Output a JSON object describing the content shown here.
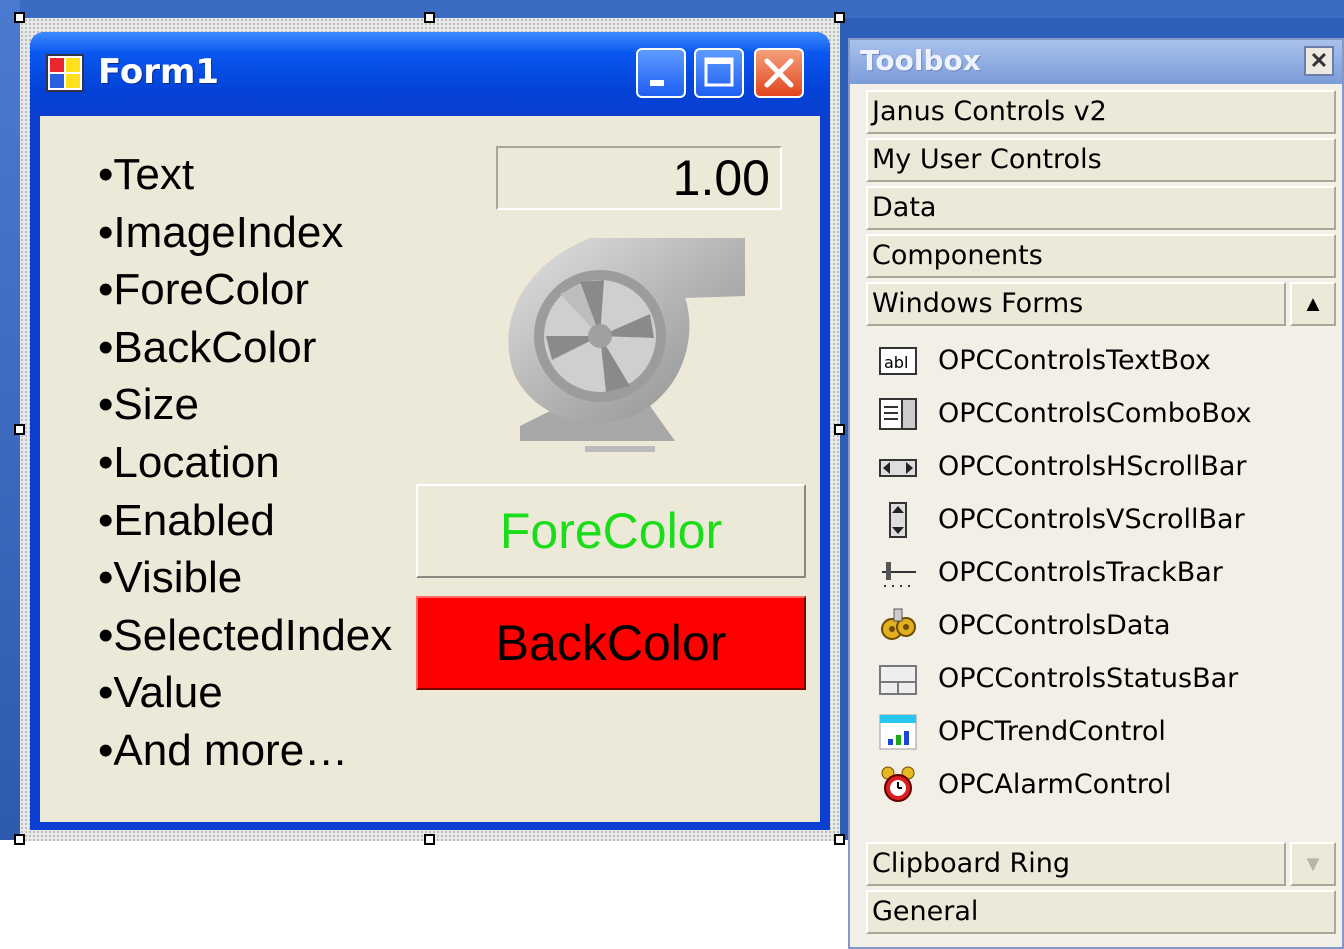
{
  "form": {
    "title": "Form1",
    "properties": [
      "•Text",
      "•ImageIndex",
      "•ForeColor",
      "•BackColor",
      "•Size",
      "•Location",
      "•Enabled",
      "•Visible",
      "•SelectedIndex",
      "•Value",
      "•And more…"
    ],
    "numeric_value": "1.00",
    "forecolor_button": "ForeColor",
    "backcolor_button": "BackColor",
    "colors": {
      "forecolor_text": "#18dd18",
      "backcolor_fill": "#ff0000"
    }
  },
  "toolbox": {
    "title": "Toolbox",
    "categories_top": [
      "Janus Controls v2",
      "My User Controls",
      "Data",
      "Components",
      "Windows Forms"
    ],
    "tools": [
      {
        "label": "OPCControlsTextBox",
        "icon": "textbox-icon"
      },
      {
        "label": "OPCControlsComboBox",
        "icon": "combobox-icon"
      },
      {
        "label": "OPCControlsHScrollBar",
        "icon": "hscrollbar-icon"
      },
      {
        "label": "OPCControlsVScrollBar",
        "icon": "vscrollbar-icon"
      },
      {
        "label": "OPCControlsTrackBar",
        "icon": "trackbar-icon"
      },
      {
        "label": "OPCControlsData",
        "icon": "data-gear-icon"
      },
      {
        "label": "OPCControlsStatusBar",
        "icon": "statusbar-icon"
      },
      {
        "label": "OPCTrendControl",
        "icon": "trend-chart-icon"
      },
      {
        "label": "OPCAlarmControl",
        "icon": "alarm-clock-icon"
      }
    ],
    "categories_bottom": [
      "Clipboard Ring",
      "General"
    ]
  }
}
